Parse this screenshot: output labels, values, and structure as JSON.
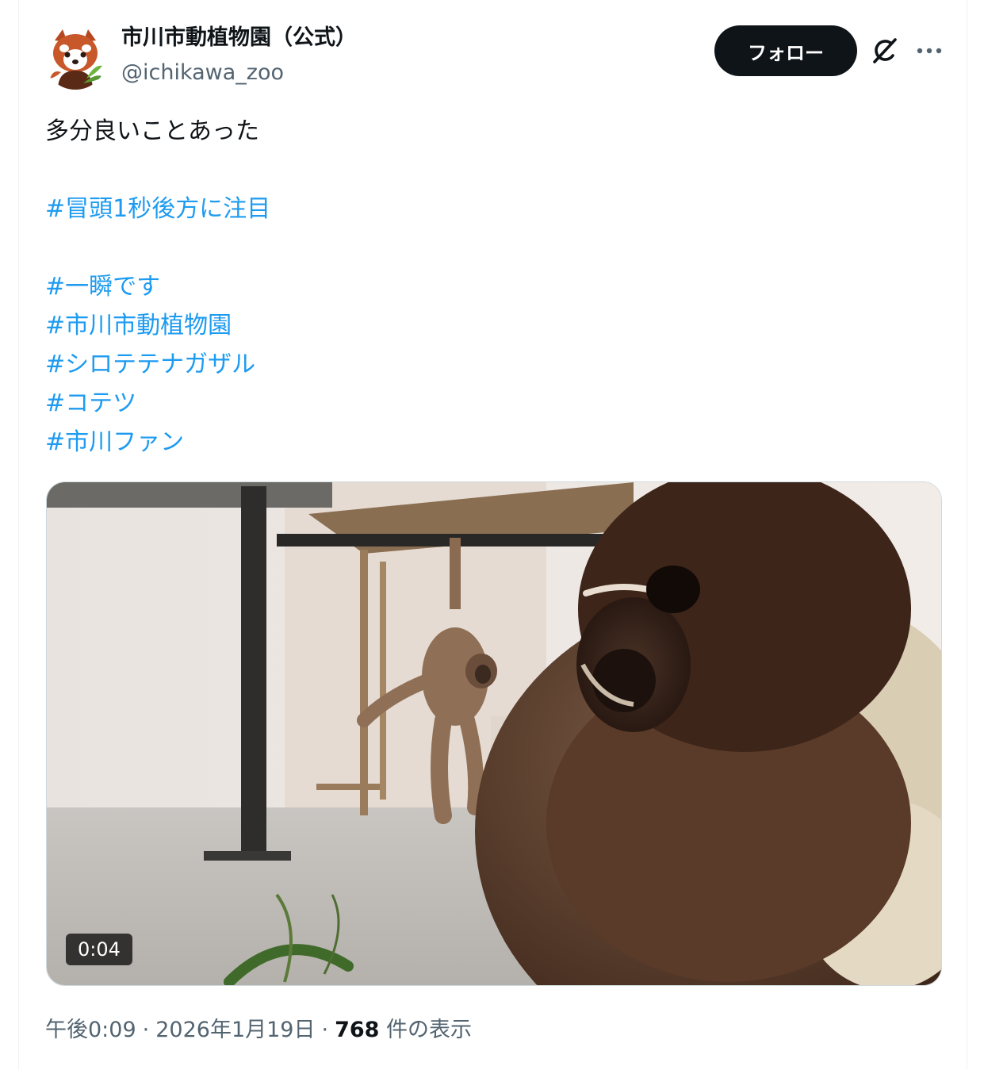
{
  "author": {
    "display_name": "市川市動植物園（公式）",
    "handle": "@ichikawa_zoo",
    "avatar_icon": "red-panda-avatar"
  },
  "actions": {
    "follow_label": "フォロー",
    "grok_icon": "grok-icon",
    "more_icon": "more-icon"
  },
  "tweet": {
    "text": "多分良いことあった",
    "hashtags": [
      "#冒頭1秒後方に注目",
      "#一瞬です",
      "#市川市動植物園",
      "#シロテテナガザル",
      "#コテツ",
      "#市川ファン"
    ]
  },
  "media": {
    "type": "video",
    "duration": "0:04"
  },
  "meta": {
    "time": "午後0:09",
    "separator": "·",
    "date": "2026年1月19日",
    "views_count": "768",
    "views_label": "件の表示"
  },
  "colors": {
    "link": "#1d9bf0",
    "button_bg": "#0f1419",
    "secondary_text": "#536471"
  }
}
